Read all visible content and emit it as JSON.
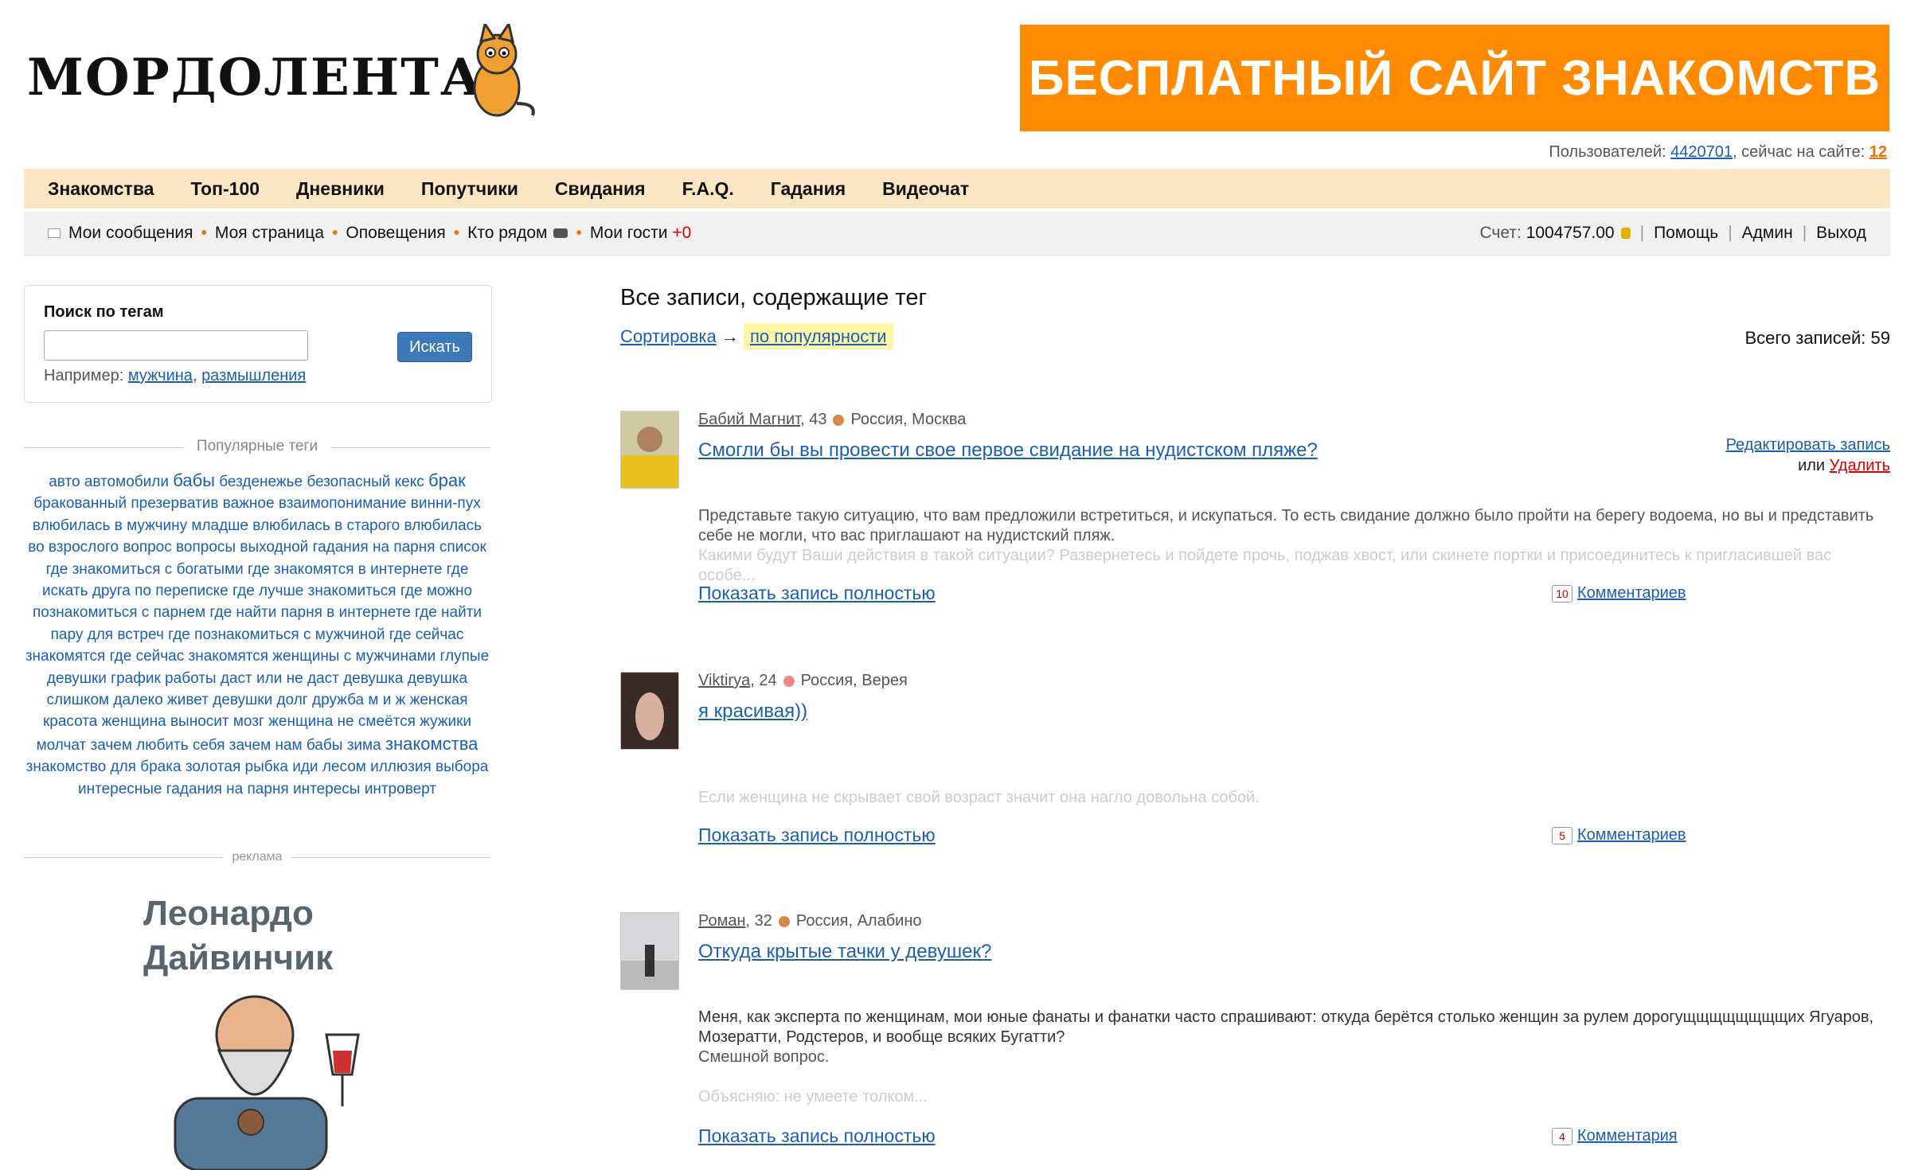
{
  "header": {
    "logo_text": "МОРДОЛЕНТА",
    "banner": "БЕСПЛАТНЫЙ САЙТ ЗНАКОМСТВ",
    "users_label": "Пользователей:",
    "users_count": "4420701",
    "online_label": ", сейчас на сайте:",
    "online_count": "12"
  },
  "main_nav": [
    "Знакомства",
    "Топ-100",
    "Дневники",
    "Попутчики",
    "Свидания",
    "F.A.Q.",
    "Гадания",
    "Видеочат"
  ],
  "sub_nav": {
    "messages": "Мои сообщения",
    "my_page": "Моя страница",
    "notifications": "Оповещения",
    "nearby": "Кто рядом",
    "guests": "Мои гости",
    "guests_count": "+0",
    "balance_label": "Счет:",
    "balance": "1004757.00",
    "help": "Помощь",
    "admin": "Админ",
    "logout": "Выход"
  },
  "search": {
    "title": "Поиск по тегам",
    "button": "Искать",
    "example_label": "Например:",
    "example1": "мужчина",
    "example2": "размышления"
  },
  "tags": {
    "title": "Популярные теги",
    "list": [
      "авто",
      "автомобили",
      "бабы",
      "безденежье",
      "безопасный",
      "кекс",
      "брак",
      "бракованный",
      "презерватив",
      "важное",
      "взаимопонимание",
      "винни-пух",
      "влюбилась в мужчину",
      "младше",
      "влюбилась в старого",
      "влюбилась во взрослого",
      "вопрос",
      "вопросы",
      "выходной",
      "гадания на парня",
      "список",
      "где знакомиться с богатыми",
      "где знакомятся в интернете",
      "где искать друга по переписке",
      "где лучше знакомиться",
      "где можно познакомиться с парнем",
      "где найти парня в интернете",
      "где найти пару для встреч",
      "где познакомиться с мужчиной",
      "где сейчас знакомятся",
      "где сейчас знакомятся женщины с мужчинами",
      "глупые девушки",
      "график работы",
      "даст или не даст",
      "девушка",
      "девушка слишком далеко живет",
      "девушки",
      "долг",
      "дружба",
      "м и ж",
      "женская красота",
      "женщина выносит мозг",
      "женщина не смеётся",
      "жужики",
      "молчат",
      "зачем любить себя",
      "зачем нам бабы",
      "зима",
      "знакомства",
      "знакомство для брака",
      "золотая рыбка",
      "иди лесом",
      "иллюзия выбора",
      "интересные гадания на парня",
      "интересы",
      "интроверт"
    ],
    "big": [
      "бабы",
      "брак",
      "знакомства"
    ]
  },
  "ad": {
    "label": "реклама",
    "title_line1": "Леонардо",
    "title_line2": "Дайвинчик"
  },
  "content": {
    "title": "Все записи, содержащие тег",
    "sort_label": "Сортировка",
    "sort_arrow": "→",
    "sort_value": "по популярности",
    "total": "Всего записей: 59"
  },
  "posts": [
    {
      "author": "Бабий Магнит",
      "age": ", 43",
      "location": "Россия, Москва",
      "title": "Смогли бы вы провести свое первое свидание на нудистском пляже?",
      "body": "Представьте такую ситуацию, что вам предложили встретиться, и искупаться. То есть свидание должно было пройти на берегу водоема, но вы и представить себе не могли, что вас приглашают на нудистский пляж.",
      "body_fade": "Какими будут Ваши действия в такой ситуации? Развернетесь и пойдете прочь, поджав хвост, или скинете портки и присоединитесь к пригласившей вас особе...",
      "show_full": "Показать запись полностью",
      "comments_count": "10",
      "comments_label": "Комментариев",
      "edit": "Редактировать запись",
      "or": "или",
      "delete": "Удалить"
    },
    {
      "author": "Viktirya",
      "age": ", 24",
      "location": "Россия, Верея",
      "title": "я красивая))",
      "body_fade": "Если женщина не скрывает свой возраст значит она нагло довольна собой.",
      "show_full": "Показать запись полностью",
      "comments_count": "5",
      "comments_label": "Комментариев"
    },
    {
      "author": "Роман",
      "age": ", 32",
      "location": "Россия, Алабино",
      "title": "Откуда крытые тачки у девушек?",
      "body": "Меня, как эксперта по женщинам, мои юные фанаты и фанатки часто спрашивают: откуда берётся столько женщин за рулем дорогущщщщщщщщих Ягуаров, Мозератти, Родстеров, и вообще всяких Бугатти?",
      "body2": "Смешной вопрос.",
      "body_fade": "Объясняю: не умеете толком...",
      "show_full": "Показать запись полностью",
      "comments_count": "4",
      "comments_label": "Комментария"
    }
  ],
  "colors": {
    "banner_bg": "#ff8a00",
    "nav_bg": "#fbe6c4",
    "link": "#1a5fb4",
    "accent_orange": "#f07000",
    "delete_red": "#dd0000"
  }
}
